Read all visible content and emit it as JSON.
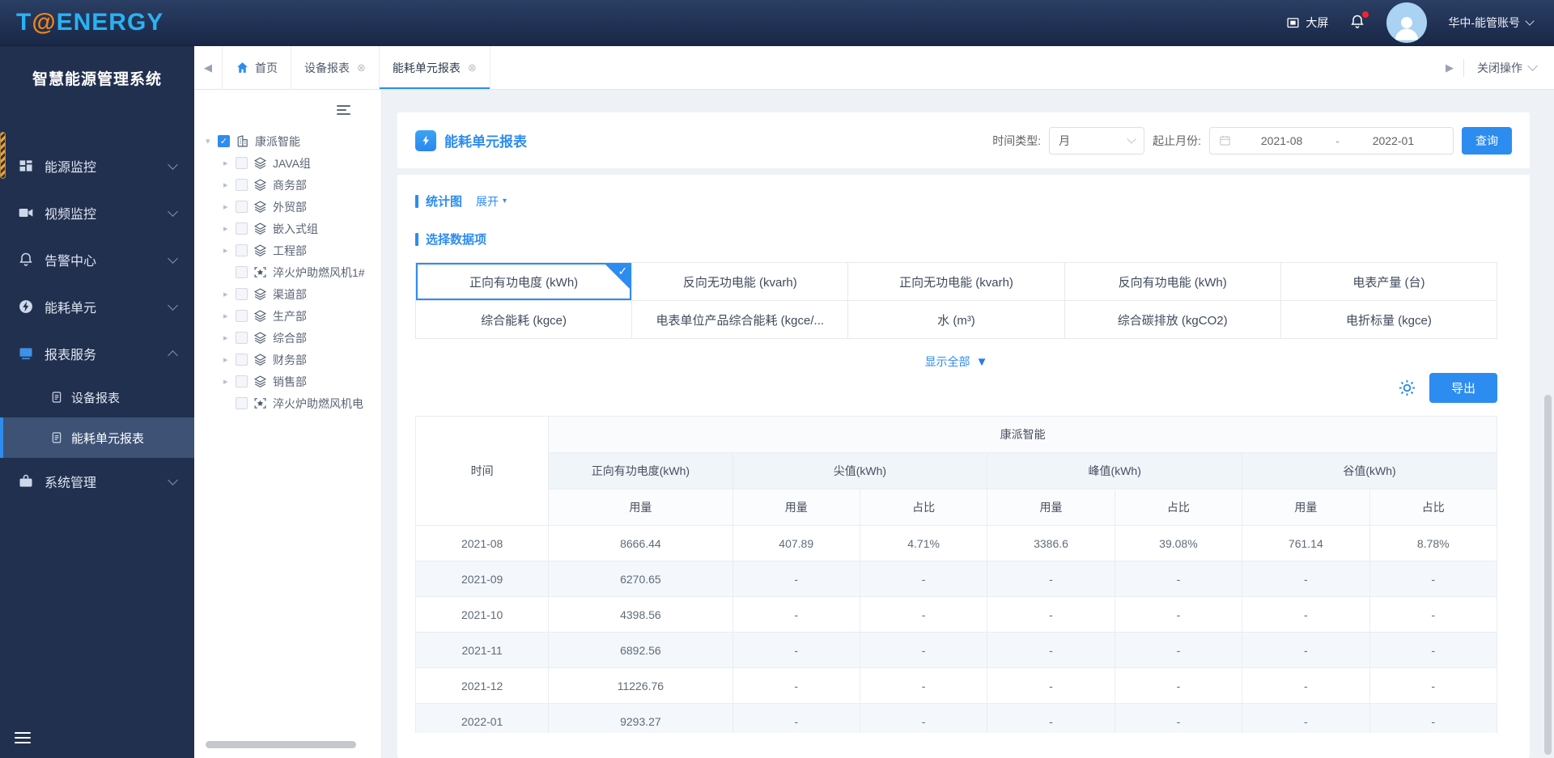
{
  "header": {
    "logo_t": "T",
    "logo_at": "@",
    "logo_rest": "ENERGY",
    "big_screen_label": "大屏",
    "account_label": "华中-能管账号"
  },
  "sidebar": {
    "title": "智慧能源管理系统",
    "menu": [
      {
        "label": "能源监控",
        "icon": "energy-monitor",
        "chevron": "down"
      },
      {
        "label": "视频监控",
        "icon": "video-monitor",
        "chevron": "down"
      },
      {
        "label": "告警中心",
        "icon": "alarm-center",
        "chevron": "down"
      },
      {
        "label": "能耗单元",
        "icon": "energy-unit",
        "chevron": "down"
      },
      {
        "label": "报表服务",
        "icon": "report-service",
        "chevron": "up",
        "expanded": true,
        "children": [
          {
            "label": "设备报表",
            "active": false
          },
          {
            "label": "能耗单元报表",
            "active": true
          }
        ]
      },
      {
        "label": "系统管理",
        "icon": "system-manage",
        "chevron": "down"
      }
    ]
  },
  "tabbar": {
    "home_label": "首页",
    "tabs": [
      {
        "label": "设备报表",
        "active": false
      },
      {
        "label": "能耗单元报表",
        "active": true
      }
    ],
    "close_ops_label": "关闭操作"
  },
  "tree": {
    "root": {
      "label": "康派智能",
      "checked": true
    },
    "children": [
      {
        "label": "JAVA组",
        "type": "dept"
      },
      {
        "label": "商务部",
        "type": "dept"
      },
      {
        "label": "外贸部",
        "type": "dept"
      },
      {
        "label": "嵌入式组",
        "type": "dept"
      },
      {
        "label": "工程部",
        "type": "dept"
      },
      {
        "label": "淬火炉助燃风机1#",
        "type": "device"
      },
      {
        "label": "渠道部",
        "type": "dept"
      },
      {
        "label": "生产部",
        "type": "dept"
      },
      {
        "label": "综合部",
        "type": "dept"
      },
      {
        "label": "财务部",
        "type": "dept"
      },
      {
        "label": "销售部",
        "type": "dept"
      },
      {
        "label": "淬火炉助燃风机电",
        "type": "device"
      }
    ]
  },
  "report": {
    "title": "能耗单元报表",
    "filters": {
      "time_type_label": "时间类型:",
      "time_type_value": "月",
      "date_range_label": "起止月份:",
      "date_start": "2021-08",
      "date_separator": "-",
      "date_end": "2022-01",
      "query_label": "查询"
    },
    "sections": {
      "chart_label": "统计图",
      "expand_label": "展开",
      "data_item_label": "选择数据项"
    },
    "data_items": [
      {
        "label": "正向有功电度 (kWh)",
        "selected": true
      },
      {
        "label": "反向无功电能 (kvarh)",
        "selected": false
      },
      {
        "label": "正向无功电能 (kvarh)",
        "selected": false
      },
      {
        "label": "反向有功电能 (kWh)",
        "selected": false
      },
      {
        "label": "电表产量 (台)",
        "selected": false
      },
      {
        "label": "综合能耗 (kgce)",
        "selected": false
      },
      {
        "label": "电表单位产品综合能耗 (kgce/...",
        "selected": false
      },
      {
        "label": "水 (m³)",
        "selected": false
      },
      {
        "label": "综合碳排放 (kgCO2)",
        "selected": false
      },
      {
        "label": "电折标量 (kgce)",
        "selected": false
      }
    ],
    "show_all_label": "显示全部",
    "export_label": "导出"
  },
  "table": {
    "group_header": "康派智能",
    "time_col_header": "时间",
    "col_groups": [
      {
        "label": "正向有功电度(kWh)",
        "span": 1
      },
      {
        "label": "尖值(kWh)",
        "span": 2
      },
      {
        "label": "峰值(kWh)",
        "span": 2
      },
      {
        "label": "谷值(kWh)",
        "span": 2
      }
    ],
    "sub_headers": [
      "用量",
      "用量",
      "占比",
      "用量",
      "占比",
      "用量",
      "占比"
    ],
    "rows": [
      [
        "2021-08",
        "8666.44",
        "407.89",
        "4.71%",
        "3386.6",
        "39.08%",
        "761.14",
        "8.78%"
      ],
      [
        "2021-09",
        "6270.65",
        "-",
        "-",
        "-",
        "-",
        "-",
        "-"
      ],
      [
        "2021-10",
        "4398.56",
        "-",
        "-",
        "-",
        "-",
        "-",
        "-"
      ],
      [
        "2021-11",
        "6892.56",
        "-",
        "-",
        "-",
        "-",
        "-",
        "-"
      ],
      [
        "2021-12",
        "11226.76",
        "-",
        "-",
        "-",
        "-",
        "-",
        "-"
      ],
      [
        "2022-01",
        "9293.27",
        "-",
        "-",
        "-",
        "-",
        "-",
        "-"
      ]
    ]
  },
  "icons": {
    "close_glyph": "⊗",
    "caret_right": "▸",
    "caret_down": "▾",
    "arrow_left": "◀",
    "arrow_right": "▶",
    "check": "✓",
    "big_caret_down": "▼",
    "small_caret_down": "▾"
  },
  "colors": {
    "accent": "#2d8cf0",
    "header_bg": "#203154",
    "sidebar_bg": "#22304f",
    "logo_blue": "#2ab2f2",
    "logo_orange": "#f08519"
  }
}
